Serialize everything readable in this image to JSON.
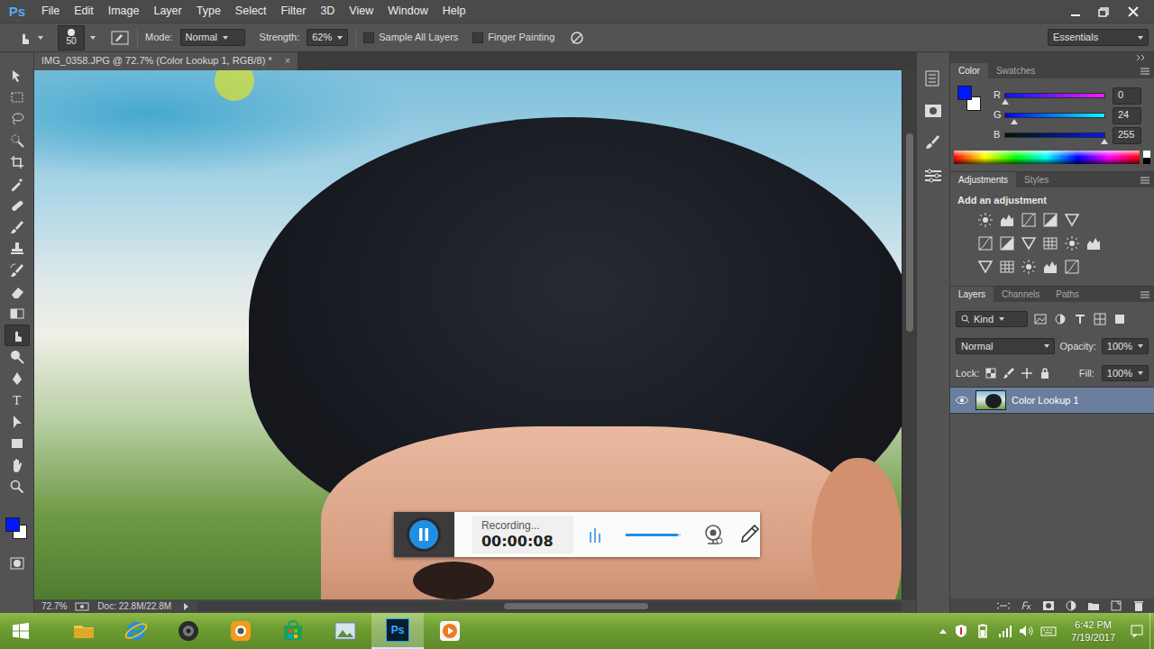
{
  "app": {
    "logo": "Ps",
    "menu": [
      "File",
      "Edit",
      "Image",
      "Layer",
      "Type",
      "Select",
      "Filter",
      "3D",
      "View",
      "Window",
      "Help"
    ]
  },
  "options_bar": {
    "brush_size": "50",
    "mode_label": "Mode:",
    "mode": "Normal",
    "strength_label": "Strength:",
    "strength": "62%",
    "checkboxes": [
      {
        "label": "Sample All Layers",
        "checked": false
      },
      {
        "label": "Finger Painting",
        "checked": false
      }
    ],
    "workspace": "Essentials"
  },
  "document": {
    "tab_title": "IMG_0358.JPG @ 72.7% (Color Lookup 1, RGB/8) *",
    "close": "×"
  },
  "tools": [
    {
      "selected": false
    },
    {
      "selected": false
    },
    {
      "selected": false
    },
    {
      "selected": false
    },
    {
      "selected": false
    },
    {
      "selected": false
    },
    {
      "selected": false
    },
    {
      "selected": false
    },
    {
      "selected": false
    },
    {
      "selected": false
    },
    {
      "selected": false
    },
    {
      "selected": false
    },
    {
      "selected": true
    },
    {
      "selected": false
    },
    {
      "selected": false
    },
    {
      "selected": false,
      "glyph": "T"
    },
    {
      "selected": false
    },
    {
      "selected": false
    },
    {
      "selected": false
    },
    {
      "selected": false
    }
  ],
  "swatches": {
    "foreground": "#0018ff",
    "background": "#ffffff"
  },
  "status_bar": {
    "zoom": "72.7%",
    "doc_size": "Doc: 22.8M/22.8M"
  },
  "color_panel": {
    "tabs": [
      {
        "label": "Color",
        "selected": true
      },
      {
        "label": "Swatches",
        "selected": false
      }
    ],
    "channels": [
      {
        "name": "R",
        "value": "0",
        "level": 0
      },
      {
        "name": "G",
        "value": "24",
        "level": 0.094
      },
      {
        "name": "B",
        "value": "255",
        "level": 1
      }
    ]
  },
  "adjustments_panel": {
    "tabs": [
      {
        "label": "Adjustments",
        "selected": true
      },
      {
        "label": "Styles",
        "selected": false
      }
    ],
    "heading": "Add an adjustment"
  },
  "layers_panel": {
    "tabs": [
      {
        "label": "Layers",
        "selected": true
      },
      {
        "label": "Channels",
        "selected": false
      },
      {
        "label": "Paths",
        "selected": false
      }
    ],
    "filter": "Kind",
    "blend_mode": "Normal",
    "opacity_label": "Opacity:",
    "opacity": "100%",
    "lock_label": "Lock:",
    "fill_label": "Fill:",
    "fill": "100%",
    "layers": [
      {
        "name": "Color Lookup 1",
        "visible": true,
        "selected": true
      }
    ]
  },
  "recorder": {
    "status": "Recording...",
    "time": "00:00:08",
    "level": 0.95
  },
  "taskbar": {
    "apps": [
      {
        "active": false
      },
      {
        "active": false
      },
      {
        "active": false
      },
      {
        "active": false
      },
      {
        "active": false
      },
      {
        "active": false
      },
      {
        "label": "Ps",
        "active": true
      },
      {
        "active": false
      }
    ],
    "time": "6:42 PM",
    "date": "7/19/2017"
  }
}
